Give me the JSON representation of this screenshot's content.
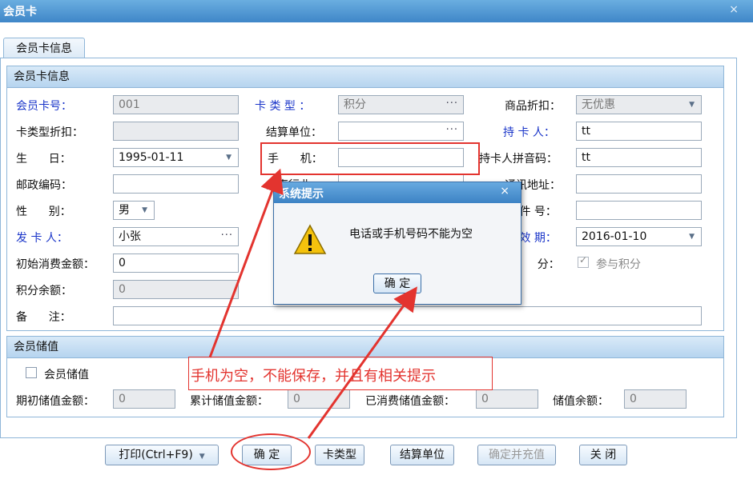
{
  "window": {
    "title": "会员卡",
    "close_glyph": "×"
  },
  "tab": {
    "label": "会员卡信息"
  },
  "info_panel": {
    "title": "会员卡信息"
  },
  "fields": {
    "card_no": {
      "label": "会员卡号：",
      "value": "001"
    },
    "card_type": {
      "label": "卡 类 型 ：",
      "value": "积分"
    },
    "goods_discount": {
      "label": "商品折扣：",
      "value": "无优惠"
    },
    "card_type_discount": {
      "label": "卡类型折扣：",
      "value": ""
    },
    "settle_unit": {
      "label": "结算单位：",
      "value": ""
    },
    "holder": {
      "label": "持 卡 人：",
      "value": "tt"
    },
    "birthday": {
      "label": "生      日：",
      "value": "1995-01-11"
    },
    "mobile": {
      "label": "手      机：",
      "value": ""
    },
    "holder_pinyin": {
      "label": "持卡人拼音码：",
      "value": "tt"
    },
    "postcode": {
      "label": "邮政编码：",
      "value": ""
    },
    "industry": {
      "label": "从事行业",
      "value": ""
    },
    "address": {
      "label": "通讯地址：",
      "value": ""
    },
    "gender": {
      "label": "性      别：",
      "value": "男"
    },
    "id_no": {
      "label": "证 件 号：",
      "value": ""
    },
    "issuer": {
      "label": "发 卡 人：",
      "value": "小张"
    },
    "valid": {
      "label": "有 效 期：",
      "value": "2016-01-10"
    },
    "initial_amount": {
      "label": "初始消费金额：",
      "value": "0"
    },
    "points": {
      "label": "积      分：",
      "check_label": "参与积分",
      "checked": true
    },
    "point_balance": {
      "label": "积分余额：",
      "value": "0"
    },
    "remark": {
      "label": "备      注：",
      "value": ""
    }
  },
  "stored_panel": {
    "title": "会员储值",
    "checkbox_label": "会员储值",
    "initial": {
      "label": "期初储值金额：",
      "value": "0"
    },
    "total": {
      "label": "累计储值金额：",
      "value": "0"
    },
    "used": {
      "label": "已消费储值金额：",
      "value": "0"
    },
    "balance": {
      "label": "储值余额：",
      "value": "0"
    }
  },
  "buttons": {
    "print": "打印(Ctrl+F9)",
    "ok": "确 定",
    "card_type": "卡类型",
    "settle_unit": "结算单位",
    "ok_and_charge": "确定并充值",
    "close": "关 闭"
  },
  "dialog": {
    "title": "系统提示",
    "close_glyph": "×",
    "message": "电话或手机号码不能为空",
    "ok": "确 定",
    "icon": "warning-icon"
  },
  "annotation": {
    "text": "手机为空，不能保存，并且有相关提示"
  },
  "colors": {
    "accent": "#3f86c8",
    "label_blue": "#1a35c9",
    "annotation_red": "#e3342f"
  }
}
